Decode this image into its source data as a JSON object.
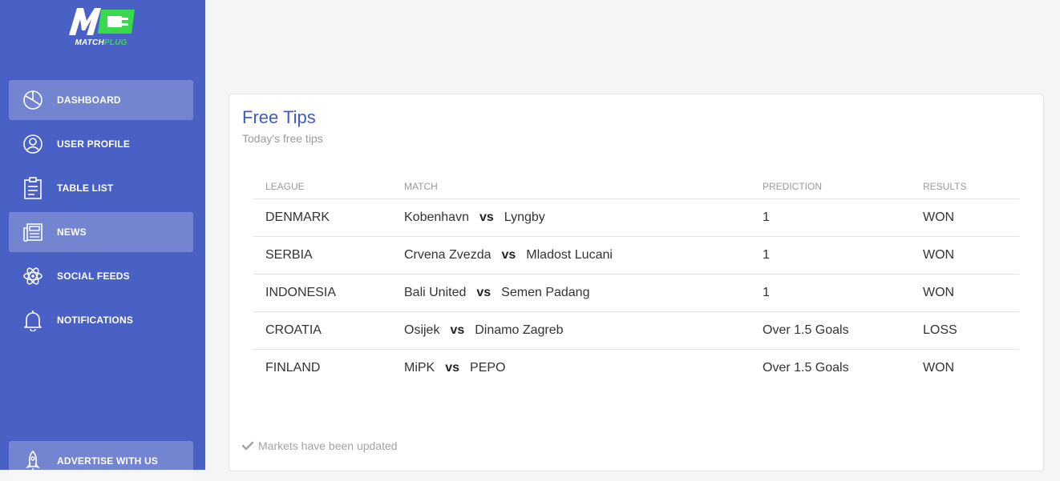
{
  "brand": {
    "logo_text_white": "MATCH",
    "logo_text_green": "PLUG",
    "accent_color": "#4960c4",
    "logo_green": "#38d94a"
  },
  "sidebar": {
    "items": [
      {
        "label": "DASHBOARD",
        "icon": "pie-chart-icon",
        "active": true
      },
      {
        "label": "USER PROFILE",
        "icon": "user-circle-icon",
        "active": false
      },
      {
        "label": "TABLE LIST",
        "icon": "clipboard-icon",
        "active": false
      },
      {
        "label": "NEWS",
        "icon": "newspaper-icon",
        "active": true
      },
      {
        "label": "SOCIAL FEEDS",
        "icon": "atom-icon",
        "active": false
      },
      {
        "label": "NOTIFICATIONS",
        "icon": "bell-icon",
        "active": false
      }
    ],
    "bottom_item": {
      "label": "ADVERTISE WITH US",
      "icon": "rocket-icon"
    }
  },
  "card": {
    "title": "Free Tips",
    "subtitle": "Today's free tips",
    "columns": [
      "LEAGUE",
      "MATCH",
      "PREDICTION",
      "RESULTS"
    ],
    "vs_label": "vs",
    "rows": [
      {
        "league": "DENMARK",
        "home": "Kobenhavn",
        "away": "Lyngby",
        "prediction": "1",
        "result": "WON"
      },
      {
        "league": "SERBIA",
        "home": "Crvena Zvezda",
        "away": "Mladost Lucani",
        "prediction": "1",
        "result": "WON"
      },
      {
        "league": "INDONESIA",
        "home": "Bali United",
        "away": "Semen Padang",
        "prediction": "1",
        "result": "WON"
      },
      {
        "league": "CROATIA",
        "home": "Osijek",
        "away": "Dinamo Zagreb",
        "prediction": "Over 1.5 Goals",
        "result": "LOSS"
      },
      {
        "league": "FINLAND",
        "home": "MiPK",
        "away": "PEPO",
        "prediction": "Over 1.5 Goals",
        "result": "WON"
      }
    ],
    "footer_note": "Markets have been updated",
    "footer_icon": "check-icon"
  }
}
